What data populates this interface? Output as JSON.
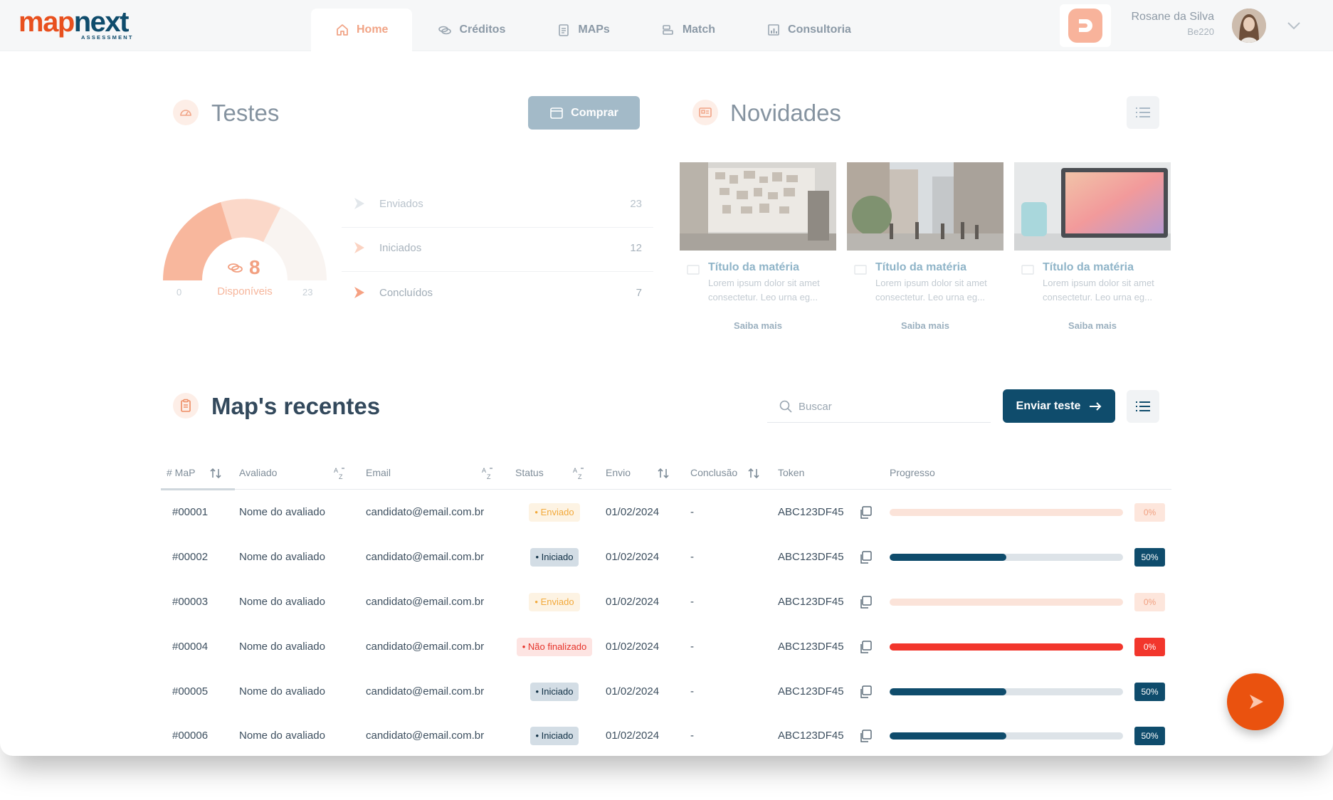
{
  "app": {
    "logo_map": "map",
    "logo_next": "next",
    "logo_sub": "ASSESSMENT"
  },
  "nav": {
    "tabs": [
      {
        "label": "Home",
        "icon": "home-icon",
        "active": true
      },
      {
        "label": "Créditos",
        "icon": "coins-icon",
        "active": false
      },
      {
        "label": "MAPs",
        "icon": "clipboard-icon",
        "active": false
      },
      {
        "label": "Match",
        "icon": "match-icon",
        "active": false
      },
      {
        "label": "Consultoria",
        "icon": "chart-icon",
        "active": false
      }
    ]
  },
  "user": {
    "name": "Rosane da Silva",
    "code": "Be220"
  },
  "testes": {
    "title": "Testes",
    "buy_label": "Comprar",
    "gauge": {
      "available": "8",
      "label": "Disponíveis",
      "min": "0",
      "max": "23"
    },
    "stats": [
      {
        "label": "Enviados",
        "value": "23"
      },
      {
        "label": "Iniciados",
        "value": "12"
      },
      {
        "label": "Concluídos",
        "value": "7"
      }
    ]
  },
  "novidades": {
    "title": "Novidades",
    "cards": [
      {
        "title": "Título da matéria",
        "body": "Lorem ipsum dolor sit amet consectetur. Leo urna eg...",
        "link": "Saiba mais",
        "image": "office-wall-photo"
      },
      {
        "title": "Título da matéria",
        "body": "Lorem ipsum dolor sit amet consectetur. Leo urna eg...",
        "link": "Saiba mais",
        "image": "city-street-photo"
      },
      {
        "title": "Título da matéria",
        "body": "Lorem ipsum dolor sit amet consectetur. Leo urna eg...",
        "link": "Saiba mais",
        "image": "laptop-desk-photo"
      }
    ]
  },
  "recent": {
    "title": "Map's recentes",
    "search_placeholder": "Buscar",
    "send_label": "Enviar teste",
    "columns": [
      "# MaP",
      "Avaliado",
      "Email",
      "Status",
      "Envio",
      "Conclusão",
      "Token",
      "Progresso"
    ],
    "rows": [
      {
        "id": "#00001",
        "name": "Nome do avaliado",
        "email": "candidato@email.com.br",
        "status": "• Enviado",
        "status_type": "enviado",
        "sent": "01/02/2024",
        "done": "-",
        "token": "ABC123DF45",
        "progress": 0,
        "progress_label": "0%",
        "progress_type": "enviado"
      },
      {
        "id": "#00002",
        "name": "Nome do avaliado",
        "email": "candidato@email.com.br",
        "status": "• Iniciado",
        "status_type": "iniciado",
        "sent": "01/02/2024",
        "done": "-",
        "token": "ABC123DF45",
        "progress": 50,
        "progress_label": "50%",
        "progress_type": "iniciado"
      },
      {
        "id": "#00003",
        "name": "Nome do avaliado",
        "email": "candidato@email.com.br",
        "status": "• Enviado",
        "status_type": "enviado",
        "sent": "01/02/2024",
        "done": "-",
        "token": "ABC123DF45",
        "progress": 0,
        "progress_label": "0%",
        "progress_type": "enviado"
      },
      {
        "id": "#00004",
        "name": "Nome do avaliado",
        "email": "candidato@email.com.br",
        "status": "• Não finalizado",
        "status_type": "nao",
        "sent": "01/02/2024",
        "done": "-",
        "token": "ABC123DF45",
        "progress": 100,
        "progress_label": "0%",
        "progress_type": "nao"
      },
      {
        "id": "#00005",
        "name": "Nome do avaliado",
        "email": "candidato@email.com.br",
        "status": "• Iniciado",
        "status_type": "iniciado",
        "sent": "01/02/2024",
        "done": "-",
        "token": "ABC123DF45",
        "progress": 50,
        "progress_label": "50%",
        "progress_type": "iniciado"
      },
      {
        "id": "#00006",
        "name": "Nome do avaliado",
        "email": "candidato@email.com.br",
        "status": "• Iniciado",
        "status_type": "iniciado",
        "sent": "01/02/2024",
        "done": "-",
        "token": "ABC123DF45",
        "progress": 50,
        "progress_label": "50%",
        "progress_type": "iniciado"
      }
    ]
  },
  "colors": {
    "brand_orange": "#ea520f",
    "brand_navy": "#0f4c6c",
    "enviado_track": "#fbe3d9",
    "enviado_pct_bg": "#fde6dc",
    "enviado_pct_text": "#f1a080",
    "iniciado_fill": "#0f4c6c",
    "iniciado_track": "#dde3e8",
    "nao_fill": "#f2362c",
    "nao_pct_bg": "#f2362c"
  }
}
